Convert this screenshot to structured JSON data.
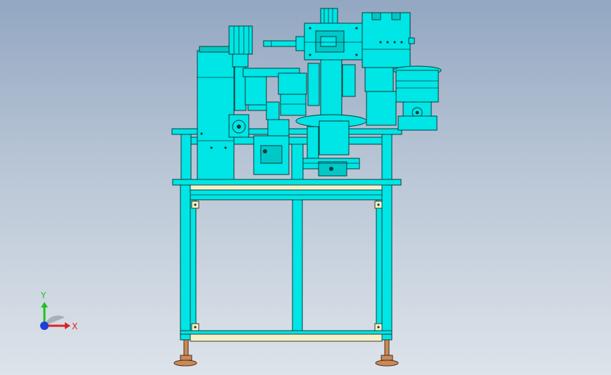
{
  "viewport": {
    "background_top": "#93a7c2",
    "background_bottom": "#dde3ea"
  },
  "model": {
    "body_color": "#00e5e5",
    "edge_color": "#0b3b3b",
    "rail_color": "#f6f0c8",
    "foot_color": "#c98a58"
  },
  "triad": {
    "y_label": "Y",
    "x_label": "X",
    "y_color": "#22c11f",
    "x_color": "#e02020",
    "z_color": "#1f3fd8"
  }
}
